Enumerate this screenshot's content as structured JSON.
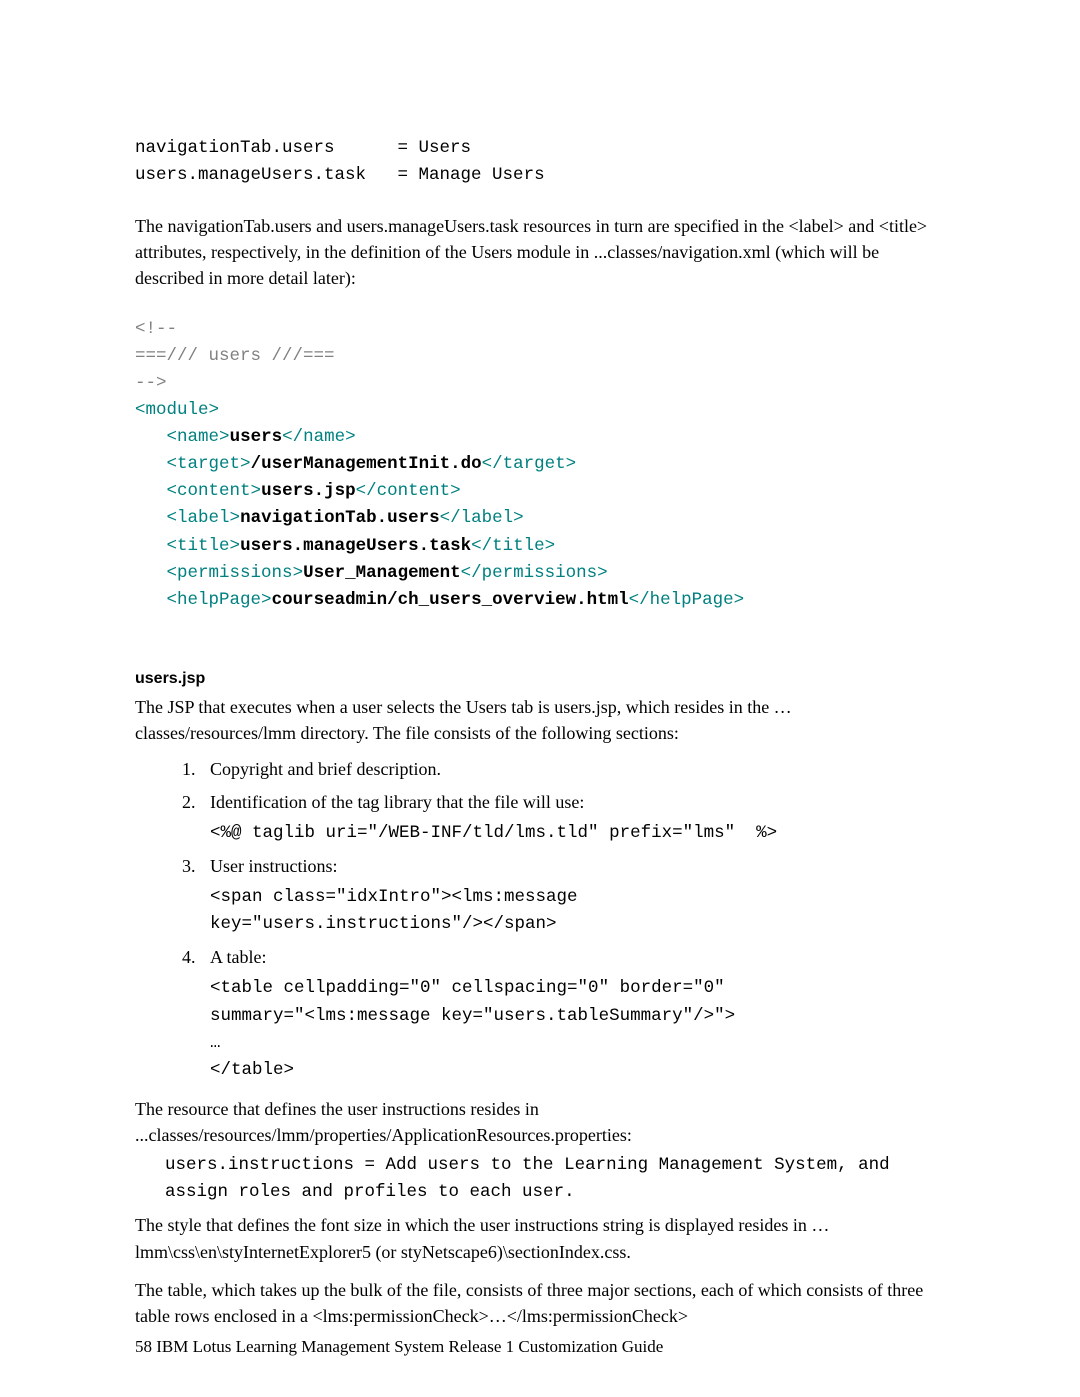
{
  "topCode_line1": "navigationTab.users      = Users",
  "topCode_line2": "users.manageUsers.task   = Manage Users",
  "para1": "The navigationTab.users and users.manageUsers.task resources in turn are specified in the <label> and <title> attributes, respectively, in the definition of the Users module in ...classes/navigation.xml (which will be described in more detail later):",
  "xml": {
    "c1": "<!--",
    "c2": "===/// users ///===",
    "c3": "-->",
    "moduleOpen": "module",
    "name": {
      "tag": "name",
      "val": "users"
    },
    "target": {
      "tag": "target",
      "val": "/userManagementInit.do"
    },
    "content": {
      "tag": "content",
      "val": "users.jsp"
    },
    "label": {
      "tag": "label",
      "val": "navigationTab.users"
    },
    "title": {
      "tag": "title",
      "val": "users.manageUsers.task"
    },
    "permissions": {
      "tag": "permissions",
      "val": "User_Management"
    },
    "helpPage": {
      "tag": "helpPage",
      "val": "courseadmin/ch_users_overview.html"
    }
  },
  "heading1": "users.jsp",
  "para2": "The JSP that executes when a user selects the Users tab is users.jsp, which resides in the …classes/resources/lmm directory. The file consists of the following sections:",
  "steps": {
    "s1": "Copyright and brief description.",
    "s2": "Identification of the tag library that the file will use:",
    "s2code": "<%@ taglib uri=\"/WEB-INF/tld/lms.tld\" prefix=\"lms\"  %>",
    "s3": "User instructions:",
    "s3code": "<span class=\"idxIntro\"><lms:message\nkey=\"users.instructions\"/></span>",
    "s4": "A table:",
    "s4code": "<table cellpadding=\"0\" cellspacing=\"0\" border=\"0\"\nsummary=\"<lms:message key=\"users.tableSummary\"/>\">\n…\n</table>"
  },
  "para3": "The resource that defines the user instructions resides in ...classes/resources/lmm/properties/ApplicationResources.properties:",
  "codeBlock1": "users.instructions = Add users to the Learning Management System, and\nassign roles and profiles to each user.",
  "para4": "The style that defines the font size in which the user instructions string is displayed resides in …lmm\\css\\en\\styInternetExplorer5 (or styNetscape6)\\sectionIndex.css.",
  "para5": "The table, which takes up the bulk of the file, consists of three major sections, each of which consists of three table rows enclosed in a <lms:permissionCheck>…</lms:permissionCheck>",
  "footer_page": "58",
  "footer_text": "IBM Lotus Learning Management System Release 1 Customization Guide"
}
